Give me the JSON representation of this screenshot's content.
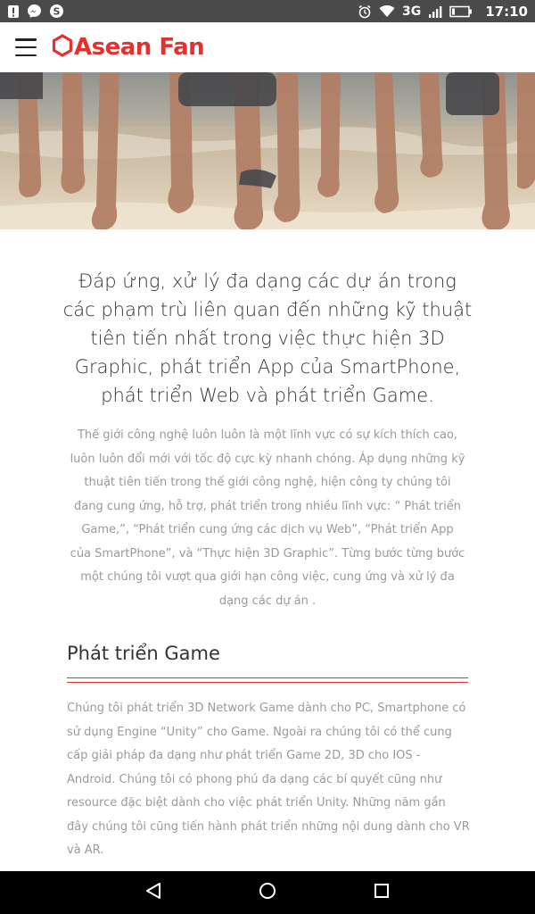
{
  "status_bar": {
    "network": "3G",
    "time": "17:10",
    "left_icons": [
      "alert-icon",
      "messenger-icon",
      "skype-icon"
    ],
    "right_icons": [
      "alarm-icon",
      "wifi-icon",
      "signal-icon",
      "battery-icon"
    ]
  },
  "header": {
    "brand_name": "Asean Fan",
    "brand_color": "#e5312d"
  },
  "hero": {
    "description_icon": "beach-feet-photo"
  },
  "intro": {
    "lead": "Đáp ứng, xử lý đa dạng các dự án trong các phạm trù liên quan đến những kỹ thuật tiên tiến nhất trong việc thực hiện 3D Graphic, phát triển App của SmartPhone, phát triển Web và phát triển Game.",
    "description": "Thế giới công nghệ luôn luôn là một lĩnh vực có sự kích thích cao, luôn luôn đổi mới với tốc độ cực kỳ nhanh chóng. Áp dụng những kỹ thuật tiên tiến trong thế giới công nghệ, hiện công ty chúng tôi đang cung ứng, hỗ trợ, phát triển trong nhiều lĩnh vực: “ Phát triển Game,”, “Phát triển cung ứng các dịch vụ Web”, “Phát triển App của SmartPhone”, và “Thực hiện 3D Graphic”. Từng bước từng bước một chúng tôi vượt qua giới hạn công việc, cung ứng và xử lý đa dạng các dự án ."
  },
  "section": {
    "title": "Phát triển Game",
    "body": "Chúng tôi phát triển 3D Network Game dành cho PC, Smartphone có sử dụng Engine “Unity” cho Game. Ngoài ra chúng tôi có thể cung cấp giải pháp đa dạng như phát triển Game 2D, 3D cho IOS - Android. Chúng tôi có phong phú đa dạng các bí quyết cũng như resource đặc biệt dành cho việc phát triển Unity. Những năm gần đây chúng tôi cũng tiến hành phát triển những nội dung dành cho VR và AR."
  },
  "nav_bar": {
    "buttons": [
      "back-icon",
      "home-icon",
      "recents-icon"
    ]
  }
}
